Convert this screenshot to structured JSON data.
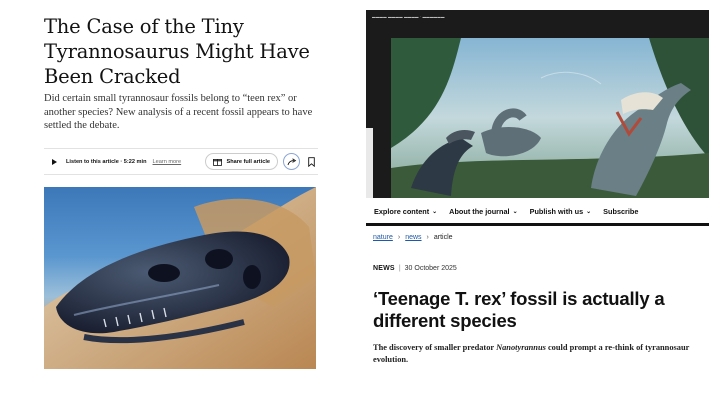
{
  "nyt": {
    "headline": "The Case of the Tiny Tyrannosaurus Might Have Been Cracked",
    "summary": "Did certain small tyrannosaur fossils belong to “teen rex” or another species? New analysis of a recent fossil appears to have settled the debate.",
    "listen_label": "Listen to this article · 5:22 min",
    "learn_more": "Learn more",
    "share_full": "Share full article",
    "icons": {
      "play": "play-icon",
      "gift": "gift-icon",
      "share": "share-arrow-icon",
      "bookmark": "bookmark-icon"
    },
    "accent": "#8aa6d6"
  },
  "nature": {
    "nav": [
      {
        "label": "Explore content",
        "has_chevron": true
      },
      {
        "label": "About the journal",
        "has_chevron": true
      },
      {
        "label": "Publish with us",
        "has_chevron": true
      },
      {
        "label": "Subscribe",
        "has_chevron": false
      }
    ],
    "breadcrumb": [
      "nature",
      "news",
      "article"
    ],
    "tag": "NEWS",
    "date": "30 October 2025",
    "title": "‘Teenage T. rex’ fossil is actually a different species",
    "standfirst_before": "The discovery of smaller predator ",
    "standfirst_italic": "Nanotyrannus",
    "standfirst_after": " could prompt a re-think of tyrannosaur evolution.",
    "link_color": "#1f5aa8"
  }
}
